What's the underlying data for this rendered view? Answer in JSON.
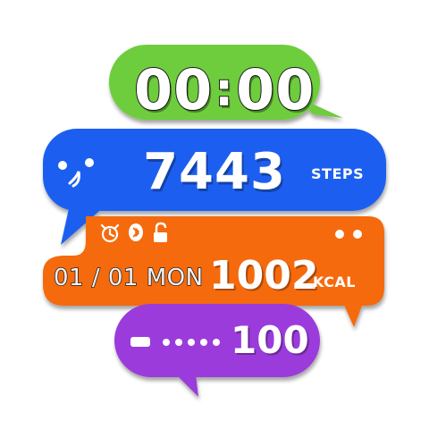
{
  "watch_face": {
    "time": {
      "hours": "00",
      "separator": ":",
      "minutes": "00"
    },
    "steps": {
      "value": "7443",
      "label": "STEPS"
    },
    "status_icons": [
      "alarm-icon",
      "bluetooth-icon",
      "unlock-icon"
    ],
    "date": {
      "text": "01 / 01 MON"
    },
    "calories": {
      "value": "1002",
      "label": "KCAL"
    },
    "battery": {
      "value": "100",
      "dots": 5
    },
    "colors": {
      "time_bubble": "#6ecd3c",
      "steps_bubble": "#1f5ef0",
      "info_bubble": "#f56a0c",
      "battery_bubble": "#9b3bdc"
    }
  }
}
